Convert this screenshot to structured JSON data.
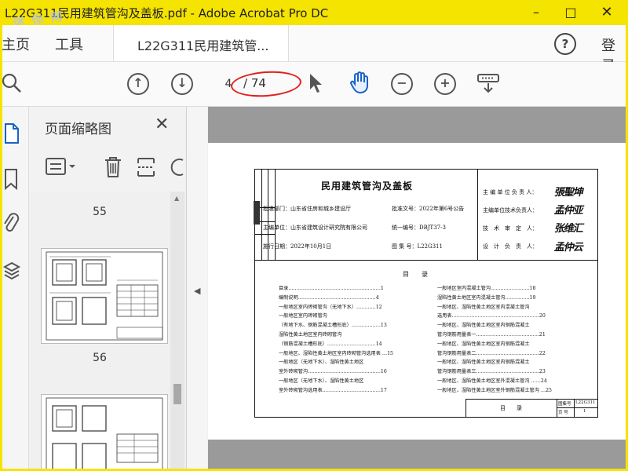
{
  "window": {
    "title": "L22G311民用建筑管沟及盖板.pdf - Adobe Acrobat Pro DC",
    "watermark": "迷 你 网"
  },
  "menu": {
    "home": "主页",
    "tools": "工具",
    "doc_tab": "L22G311民用建筑管...",
    "login": "登录"
  },
  "toolbar": {
    "current_page": "4",
    "page_total": "/ 74"
  },
  "panel": {
    "title": "页面缩略图",
    "page_labels": [
      "55",
      "56"
    ]
  },
  "document": {
    "title": "民用建筑管沟及盖板",
    "approval_dept": "批准部门：山东省住房和城乡建设厅",
    "approval_no": "批准文号：2022年第6号公告",
    "editor_unit": "主编单位：山东省建筑设计研究院有限公司",
    "unified_no": "统一编号：DBJT37-3",
    "impl_date": "施行日期：2022年10月1日",
    "atlas_no": "图 集 号：L22G311",
    "roles": [
      "主 编 单 位 负 责 人：",
      "主编单位技术负责人：",
      "技　术　审　定　人：",
      "设　计　负　责　人："
    ],
    "signatures": [
      "張聖坤",
      "孟仲亚",
      "张维汇",
      "孟仲云"
    ],
    "toc_title": "目　　录",
    "toc_left": [
      "目录…………………………………………………1",
      "编制说明…………………………………………4",
      "一般地区室内砖砌管沟（无地下水）…………12",
      "一般地区室内砖砌管沟",
      "（有地下水、钢筋混凝土槽形底）………………13",
      "湿陷性黄土地区室内砖砌管沟",
      "（钢筋混凝土槽形底）…………………………14",
      "一般地区、湿陷性黄土地区室内砖砌管沟选用表 …15",
      "一般地区（无地下水）、湿陷性黄土地区",
      "室外砖砌管沟………………………………………16",
      "一般地区（无地下水）、湿陷性黄土地区",
      "室外砖砌管沟选用表………………………………17"
    ],
    "toc_right": [
      "一般地区室内混凝土管沟……………………18",
      "湿陷性黄土地区室内混凝土管沟……………19",
      "一般地区、湿陷性黄土地区室内混凝土管沟",
      "选用表………………………………………………20",
      "一般地区、湿陷性黄土地区室内钢筋混凝土",
      "管沟钢筋用量表一…………………………………21",
      "一般地区、湿陷性黄土地区室内钢筋混凝土",
      "管沟钢筋用量表二…………………………………22",
      "一般地区、湿陷性黄土地区室内钢筋混凝土",
      "管沟钢筋用量表三…………………………………23",
      "一般地区、湿陷性黄土地区室外混凝土管沟 ……24",
      "一般地区、湿陷性黄土地区室外钢筋混凝土管沟 …25"
    ],
    "footer_label": "目　　录",
    "footer_atlas_key": "图集号",
    "footer_atlas_val": "L22G311",
    "footer_page_key": "页 号",
    "footer_page_val": "1"
  }
}
